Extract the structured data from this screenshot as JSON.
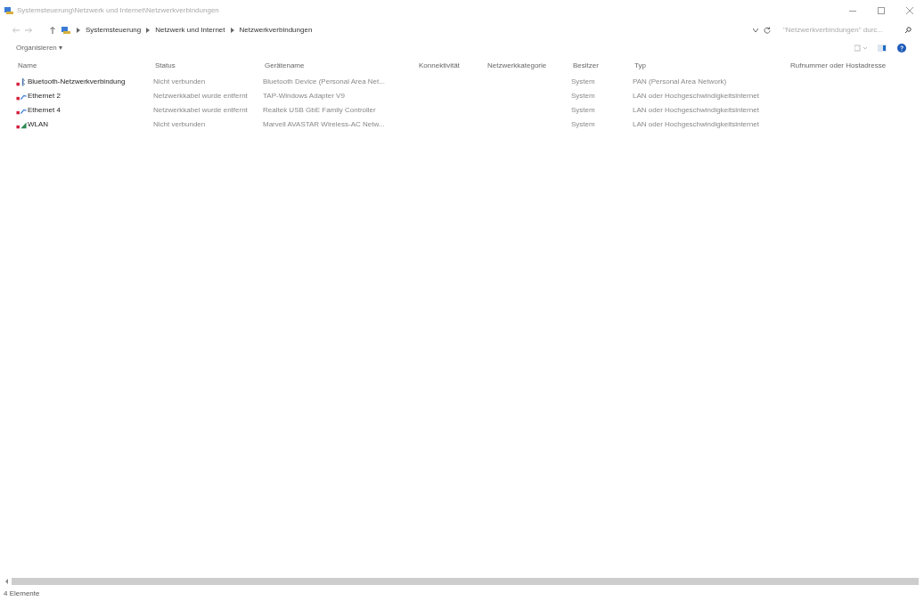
{
  "window": {
    "title": "Systemsteuerung\\Netzwerk und Internet\\Netzwerkverbindungen"
  },
  "breadcrumb": [
    "Systemsteuerung",
    "Netzwerk und Internet",
    "Netzwerkverbindungen"
  ],
  "search": {
    "placeholder": "\"Netzwerkverbindungen\" durc..."
  },
  "toolbar": {
    "organize": "Organisieren ▾"
  },
  "table": {
    "columns": [
      "Name",
      "Status",
      "Gerätename",
      "Konnektivität",
      "Netzwerkkategorie",
      "Besitzer",
      "Typ",
      "Rufnummer oder Hostadresse"
    ],
    "rows": [
      {
        "kind": "bluetooth",
        "name": "Bluetooth-Netzwerkverbindung",
        "status": "Nicht verbunden",
        "device": "Bluetooth Device (Personal Area Net...",
        "owner": "System",
        "type": "PAN (Personal Area Network)"
      },
      {
        "kind": "ethernet",
        "name": "Ethernet 2",
        "status": "Netzwerkkabel wurde entfernt",
        "device": "TAP-Windows Adapter V9",
        "owner": "System",
        "type": "LAN oder Hochgeschwindigkeitsinternet"
      },
      {
        "kind": "ethernet",
        "name": "Ethernet 4",
        "status": "Netzwerkkabel wurde entfernt",
        "device": "Realtek USB GbE Family Controller",
        "owner": "System",
        "type": "LAN oder Hochgeschwindigkeitsinternet"
      },
      {
        "kind": "wifi",
        "name": "WLAN",
        "status": "Nicht verbunden",
        "device": "Marvell AVASTAR Wireless-AC Netw...",
        "owner": "System",
        "type": "LAN oder Hochgeschwindigkeitsinternet"
      }
    ]
  },
  "status_bar": {
    "count": "4 Elemente"
  }
}
